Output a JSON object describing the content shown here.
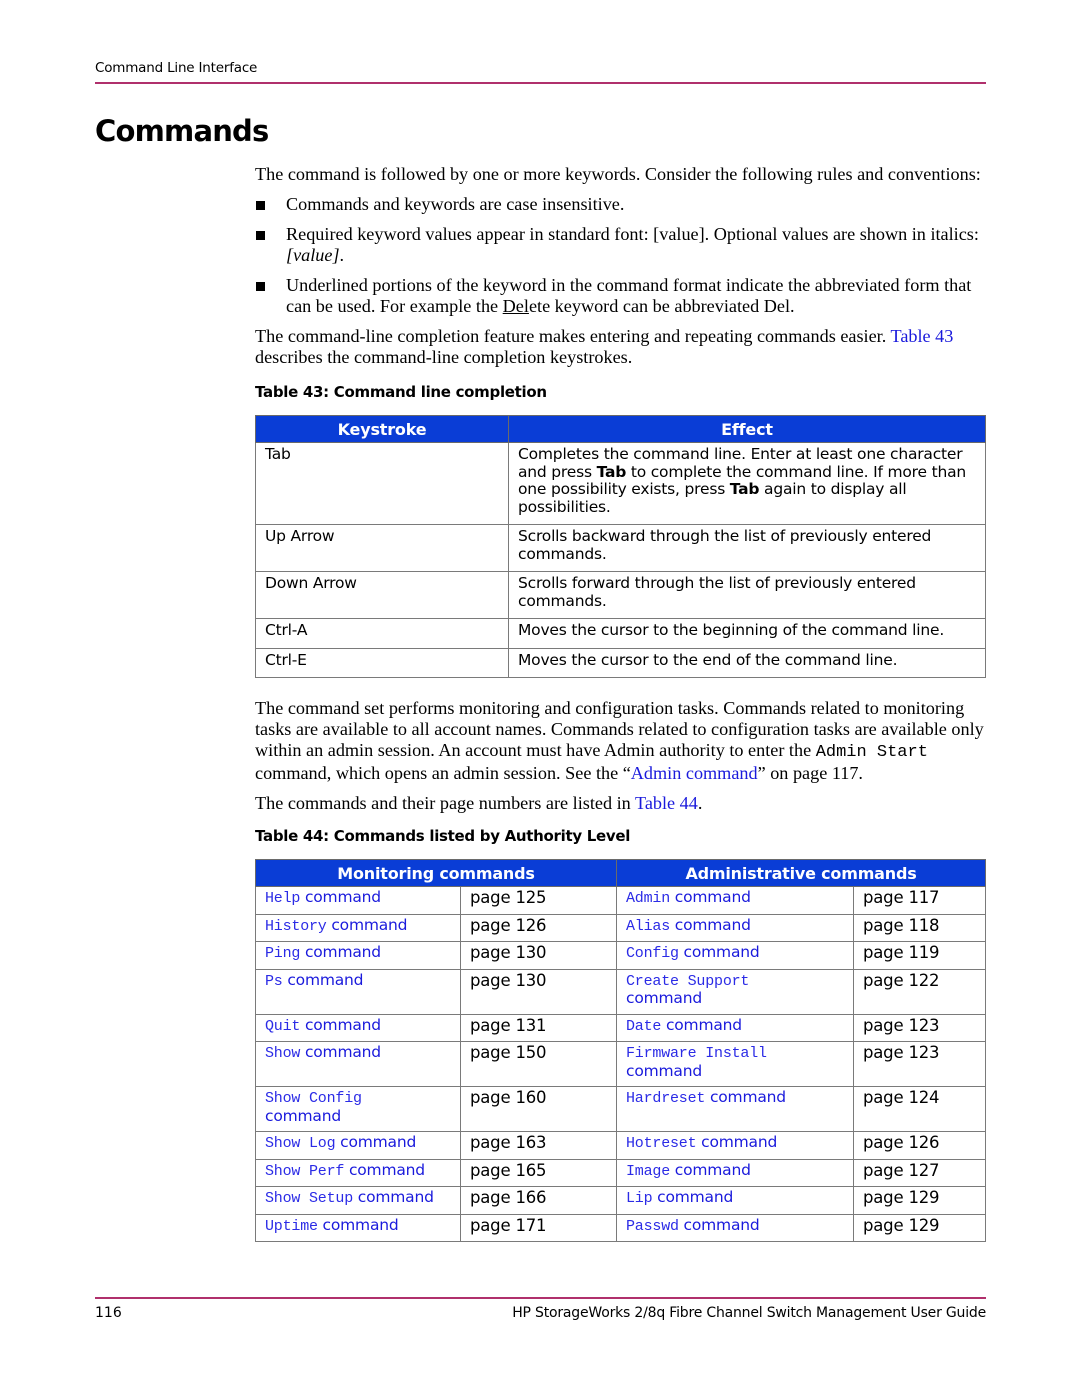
{
  "header": {
    "running_head": "Command Line Interface"
  },
  "section": {
    "title": "Commands",
    "intro": "The command is followed by one or more keywords. Consider the following rules and conventions:",
    "bullets": {
      "b1": "Commands and keywords are case insensitive.",
      "b2_pre": "Required keyword values appear in standard font: [value]. Optional values are shown in italics: ",
      "b2_italic": "[value]",
      "b2_post": ".",
      "b3_pre": "Underlined portions of the keyword in the command format indicate the abbreviated form that can be used. For example the ",
      "b3_underlined": "Del",
      "b3_mid": "ete keyword can be abbreviated Del."
    },
    "completion_para_pre": "The command-line completion feature makes entering and repeating commands easier. ",
    "completion_para_link": "Table 43",
    "completion_para_post": " describes the command-line completion keystrokes."
  },
  "table43": {
    "caption": "Table 43:  Command line completion",
    "headers": [
      "Keystroke",
      "Effect"
    ],
    "rows": [
      {
        "keystroke": "Tab",
        "effect_parts": [
          "Completes the command line. Enter at least one character and press ",
          "Tab",
          " to complete the command line. If more than one possibility exists, press ",
          "Tab",
          " again to display all possibilities."
        ]
      },
      {
        "keystroke": "Up Arrow",
        "effect": "Scrolls backward through the list of previously entered commands."
      },
      {
        "keystroke": "Down Arrow",
        "effect": "Scrolls forward through the list of previously entered commands."
      },
      {
        "keystroke": "Ctrl-A",
        "effect": "Moves the cursor to the beginning of the command line."
      },
      {
        "keystroke": "Ctrl-E",
        "effect": "Moves the cursor to the end of the command line."
      }
    ]
  },
  "authority_para": {
    "text1": "The command set performs monitoring and configuration tasks. Commands related to monitoring tasks are available to all account names. Commands related to configuration tasks are available only within an admin session. An account must have Admin authority to enter the ",
    "code": "Admin Start",
    "text2": " command, which opens an admin session. See the “",
    "link": "Admin command",
    "text3": "” on page 117."
  },
  "list_para": {
    "pre": "The commands and their page numbers are listed in ",
    "link": "Table 44",
    "post": "."
  },
  "table44": {
    "caption": "Table 44:  Commands listed by Authority Level",
    "headers": [
      "Monitoring commands",
      "Administrative commands"
    ],
    "rows": [
      {
        "mon_cmd": "Help",
        "mon_word": "command",
        "mon_page": "page 125",
        "adm_cmd": "Admin",
        "adm_word": "command",
        "adm_page": "page 117"
      },
      {
        "mon_cmd": "History",
        "mon_word": "command",
        "mon_page": "page 126",
        "adm_cmd": "Alias",
        "adm_word": "command",
        "adm_page": "page 118"
      },
      {
        "mon_cmd": "Ping",
        "mon_word": "command",
        "mon_page": "page 130",
        "adm_cmd": "Config",
        "adm_word": "command",
        "adm_page": "page 119"
      },
      {
        "mon_cmd": "Ps",
        "mon_word": "command",
        "mon_page": "page 130",
        "adm_cmd": "Create Support",
        "adm_word": "command",
        "adm_page": "page 122"
      },
      {
        "mon_cmd": "Quit",
        "mon_word": "command",
        "mon_page": "page 131",
        "adm_cmd": "Date",
        "adm_word": "command",
        "adm_page": "page 123"
      },
      {
        "mon_cmd": "Show",
        "mon_word": "command",
        "mon_page": "page 150",
        "adm_cmd": "Firmware Install",
        "adm_word": "command",
        "adm_page": "page 123"
      },
      {
        "mon_cmd": "Show Config",
        "mon_word": "command",
        "mon_page": "page 160",
        "adm_cmd": "Hardreset",
        "adm_word": "command",
        "adm_page": "page 124"
      },
      {
        "mon_cmd": "Show Log",
        "mon_word": "command",
        "mon_page": "page 163",
        "adm_cmd": "Hotreset",
        "adm_word": "command",
        "adm_page": "page 126"
      },
      {
        "mon_cmd": "Show Perf",
        "mon_word": "command",
        "mon_page": "page 165",
        "adm_cmd": "Image",
        "adm_word": "command",
        "adm_page": "page 127"
      },
      {
        "mon_cmd": "Show Setup",
        "mon_word": "command",
        "mon_page": "page 166",
        "adm_cmd": "Lip",
        "adm_word": "command",
        "adm_page": "page 129"
      },
      {
        "mon_cmd": "Uptime",
        "mon_word": "command",
        "mon_page": "page 171",
        "adm_cmd": "Passwd",
        "adm_word": "command",
        "adm_page": "page 129"
      }
    ]
  },
  "footer": {
    "page_number": "116",
    "guide_title": "HP StorageWorks 2/8q Fibre Channel Switch Management User Guide"
  },
  "colors": {
    "rule": "#b0306c",
    "table_header": "#0a3dd6",
    "link": "#1a1adc"
  }
}
